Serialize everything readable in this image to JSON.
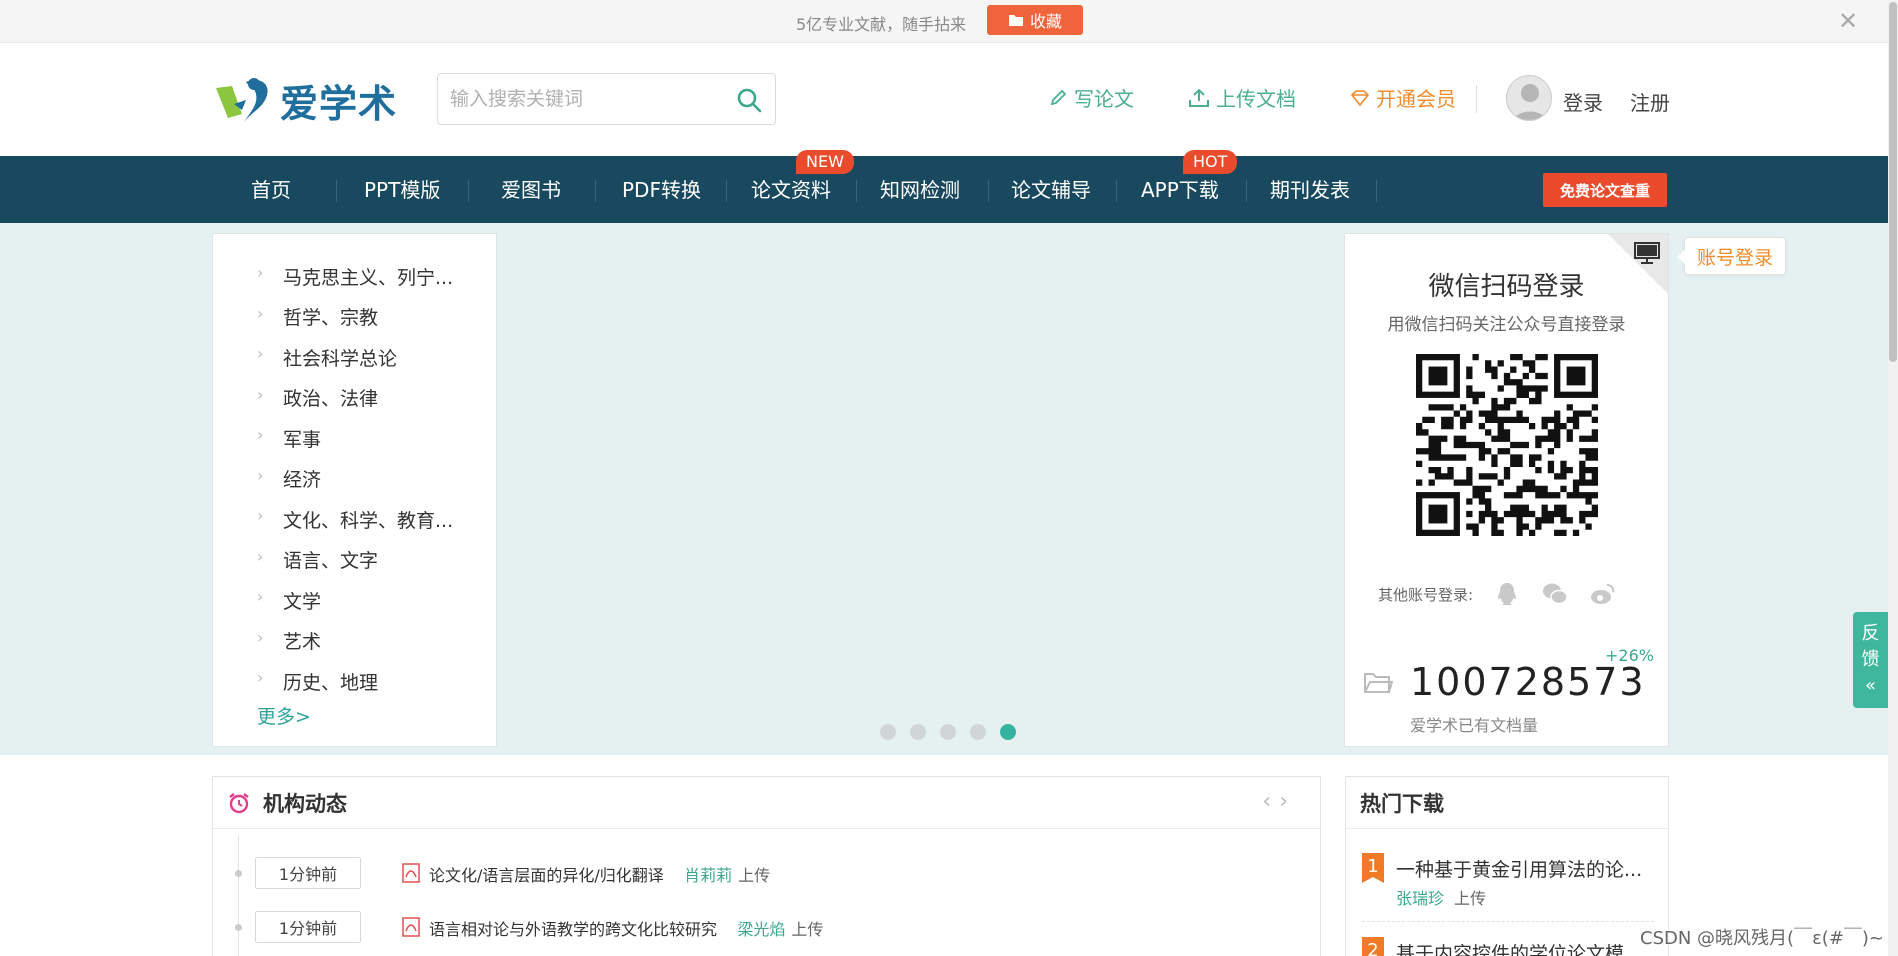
{
  "topbar": {
    "notice": "5亿专业文献，随手拈来",
    "fav_label": "收藏",
    "close_glyph": "✕"
  },
  "header": {
    "logo_text": "爱学术",
    "search": {
      "placeholder": "输入搜索关键词",
      "value": ""
    },
    "write_label": "写论文",
    "upload_label": "上传文档",
    "vip_label": "开通会员",
    "login_label": "登录",
    "register_label": "注册"
  },
  "nav": {
    "items": [
      {
        "label": "首页"
      },
      {
        "label": "PPT模版"
      },
      {
        "label": "爱图书"
      },
      {
        "label": "PDF转换"
      },
      {
        "label": "论文资料",
        "tag": "NEW"
      },
      {
        "label": "知网检测"
      },
      {
        "label": "论文辅导"
      },
      {
        "label": "APP下载",
        "tag": "HOT"
      },
      {
        "label": "期刊发表"
      }
    ],
    "free_check": "免费论文查重"
  },
  "categories": {
    "items": [
      "马克思主义、列宁...",
      "哲学、宗教",
      "社会科学总论",
      "政治、法律",
      "军事",
      "经济",
      "文化、科学、教育...",
      "语言、文字",
      "文学",
      "艺术",
      "历史、地理"
    ],
    "more": "更多>"
  },
  "carousel": {
    "slides": 5,
    "active_index": 4
  },
  "login_panel": {
    "title": "微信扫码登录",
    "subtitle": "用微信扫码关注公众号直接登录",
    "other_login": "其他账号登录:",
    "growth": "+26%",
    "doc_count": "100728573",
    "doc_caption": "爱学术已有文档量",
    "account_login_tip": "账号登录"
  },
  "dynamics": {
    "title": "机构动态",
    "rows": [
      {
        "time": "1分钟前",
        "doc": "论文化/语言层面的异化/归化翻译",
        "user": "肖莉莉",
        "action": "上传"
      },
      {
        "time": "1分钟前",
        "doc": "语言相对论与外语教学的跨文化比较研究",
        "user": "梁光焰",
        "action": "上传"
      }
    ]
  },
  "hot_downloads": {
    "title": "热门下载",
    "items": [
      {
        "rank": "1",
        "title": "一种基于黄金引用算法的论...",
        "user": "张瑞珍",
        "action": "上传"
      },
      {
        "rank": "2",
        "title": "基于内容控件的学位论文模..."
      }
    ]
  },
  "feedback": {
    "label_1": "反",
    "label_2": "馈",
    "arrow": "«"
  },
  "watermark": "CSDN @晓风残月(￣ε(#￣)~",
  "colors": {
    "nav_bg": "#19495e",
    "accent_orange": "#ea4b2c",
    "green": "#3aa88f",
    "banner_bg": "#e5f0f1"
  }
}
